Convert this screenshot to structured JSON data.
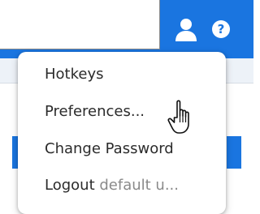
{
  "header": {
    "user_icon": "user-icon",
    "help_icon": "help-icon",
    "accent_color": "#1a75e0"
  },
  "menu": {
    "items": [
      {
        "label": "Hotkeys"
      },
      {
        "label": "Preferences..."
      },
      {
        "label": "Change Password"
      },
      {
        "label": "Logout",
        "user": "default u..."
      }
    ]
  },
  "cursor": {
    "icon": "hand-pointer-icon"
  }
}
